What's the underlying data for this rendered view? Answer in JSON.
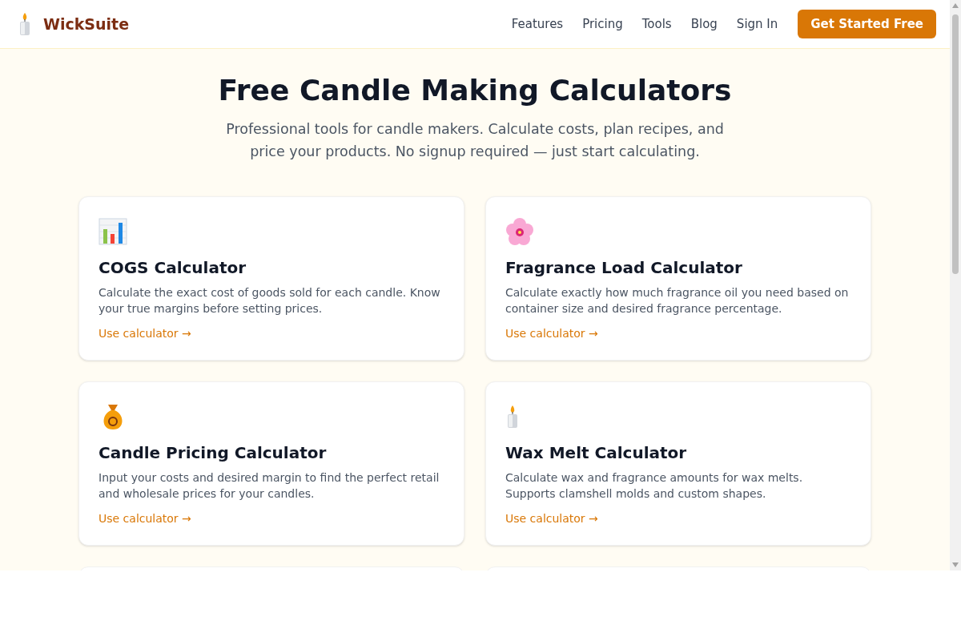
{
  "brand": {
    "name": "WickSuite"
  },
  "nav": {
    "links": [
      "Features",
      "Pricing",
      "Tools",
      "Blog",
      "Sign In"
    ],
    "cta": "Get Started Free"
  },
  "hero": {
    "title": "Free Candle Making Calculators",
    "subtitle": "Professional tools for candle makers. Calculate costs, plan recipes, and price your products. No signup required — just start calculating."
  },
  "cards": [
    {
      "kind": "chart",
      "title": "COGS Calculator",
      "description": "Calculate the exact cost of goods sold for each candle. Know your true margins before setting prices.",
      "link": "Use calculator →"
    },
    {
      "kind": "flower",
      "title": "Fragrance Load Calculator",
      "description": "Calculate exactly how much fragrance oil you need based on container size and desired fragrance percentage.",
      "link": "Use calculator →"
    },
    {
      "kind": "money",
      "title": "Candle Pricing Calculator",
      "description": "Input your costs and desired margin to find the perfect retail and wholesale prices for your candles.",
      "link": "Use calculator →"
    },
    {
      "kind": "candle",
      "title": "Wax Melt Calculator",
      "description": "Calculate wax and fragrance amounts for wax melts. Supports clamshell molds and custom shapes.",
      "link": "Use calculator →"
    },
    {
      "kind": "partial"
    },
    {
      "kind": "partial"
    }
  ]
}
